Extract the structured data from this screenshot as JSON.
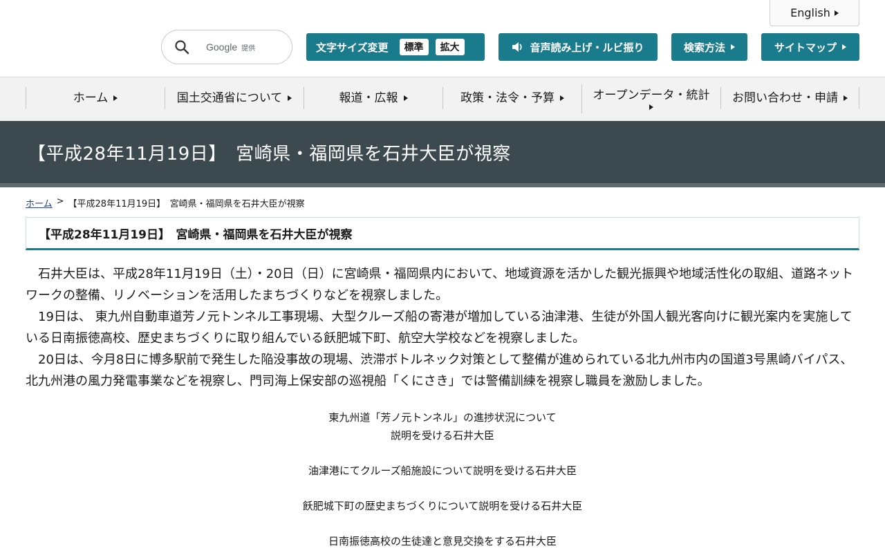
{
  "header": {
    "english_label": "English",
    "search": {
      "google_label": "Google",
      "google_sub": "提供"
    },
    "font_size": {
      "label": "文字サイズ変更",
      "standard": "標準",
      "large": "拡大"
    },
    "voice_label": "音声読み上げ・ルビ振り",
    "search_method_label": "検索方法",
    "sitemap_label": "サイトマップ",
    "accent_color": "#1a7b8c"
  },
  "nav": {
    "items": [
      {
        "label": "ホーム"
      },
      {
        "label": "国土交通省について"
      },
      {
        "label": "報道・広報"
      },
      {
        "label": "政策・法令・予算"
      },
      {
        "label": "オープンデータ・統計"
      },
      {
        "label": "お問い合わせ・申請"
      }
    ]
  },
  "page": {
    "title": "【平成28年11月19日】　宮崎県・福岡県を石井大臣が視察",
    "title_band_color": "#3c4a50"
  },
  "breadcrumb": {
    "home": "ホーム",
    "separator": ">",
    "current": "【平成28年11月19日】　宮崎県・福岡県を石井大臣が視察"
  },
  "article": {
    "heading": "【平成28年11月19日】　宮崎県・福岡県を石井大臣が視察",
    "paragraphs": [
      "石井大臣は、平成28年11月19日（土）・20日（日）に宮崎県・福岡県内において、地域資源を活かした観光振興や地域活性化の取組、道路ネットワークの整備、リノベーションを活用したまちづくりなどを視察しました。",
      "19日は、 東九州自動車道芳ノ元トンネル工事現場、大型クルーズ船の寄港が増加している油津港、生徒が外国人観光客向けに観光案内を実施している日南振徳高校、歴史まちづくりに取り組んでいる飫肥城下町、航空大学校などを視察しました。",
      "20日は、今月8日に博多駅前で発生した陥没事故の現場、渋滞ボトルネック対策として整備が進められている北九州市内の国道3号黒崎バイパス、北九州港の風力発電事業などを視察し、門司海上保安部の巡視船「くにさき」では警備訓練を視察し職員を激励しました。"
    ],
    "captions": [
      {
        "line1": "東九州道「芳ノ元トンネル」の進捗状況について",
        "line2": "説明を受ける石井大臣"
      },
      {
        "line1": "油津港にてクルーズ船施設について説明を受ける石井大臣"
      },
      {
        "line1": "飫肥城下町の歴史まちづくりについて説明を受ける石井大臣"
      },
      {
        "line1": "日南振徳高校の生徒達と意見交換をする石井大臣"
      }
    ]
  }
}
